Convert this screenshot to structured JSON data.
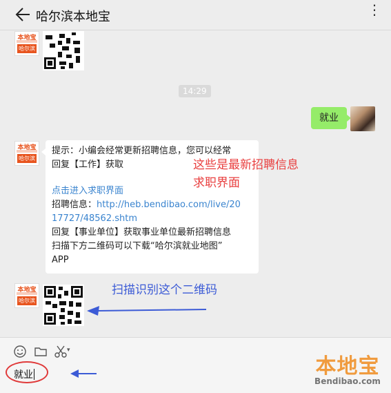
{
  "header": {
    "title": "哈尔滨本地宝",
    "more_glyph": "⋮"
  },
  "avatar": {
    "top": "本地宝",
    "bottom": "哈尔滨"
  },
  "timestamp": "14:29",
  "user_message": "就业",
  "bot_message": {
    "lines": [
      "提示：小编会经常更新招聘信息，您可以经常",
      "回复【工作】获取",
      "",
      "点击进入求职界面",
      "招聘信息：http://heb.bendibao.com/live/20",
      "17727/48562.shtm",
      "回复【事业单位】获取事业单位最新招聘信息",
      "扫描下方二维码可以下载“哈尔滨就业地图”",
      "APP"
    ],
    "link_text": "点击进入求职界面",
    "url_label": "招聘信息：",
    "url_line1": "http://heb.bendibao.com/live/20",
    "url_line2": "17727/48562.shtm"
  },
  "annotations": {
    "red_line1": "这些是最新招聘信息",
    "red_line2": "求职界面",
    "blue_text": "扫描识别这个二维码"
  },
  "input": {
    "value": "就业"
  },
  "toolbar": {
    "icons": [
      "emoji-icon",
      "folder-icon",
      "scissors-icon"
    ],
    "scissors_arrow": "▾"
  },
  "watermark": {
    "cn": "本地宝",
    "en": "Bendibao.com"
  },
  "colors": {
    "user_bubble": "#95ec69",
    "link": "#3a84cf",
    "annotation_red": "#e94040",
    "annotation_blue": "#3c5bd6",
    "watermark": "#f08c1f"
  }
}
